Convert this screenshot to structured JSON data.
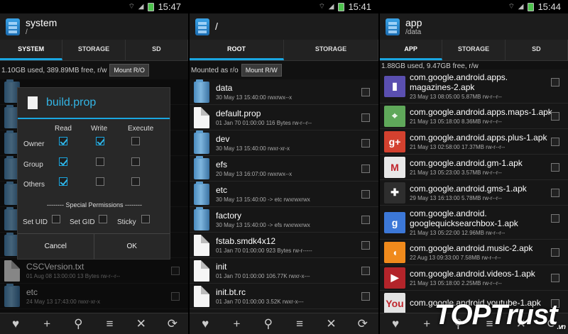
{
  "left": {
    "time": "15:47",
    "title": "system",
    "subtitle": "/",
    "tabs": [
      "SYSTEM",
      "STORAGE",
      "SD"
    ],
    "info": "1.10GB used, 389.89MB free, r/w",
    "mount_label": "Mount R/O",
    "bottom_items": [
      {
        "name": "CSCVersion.txt",
        "meta": "01 Aug 08 13:00:00   13 Bytes   rw-r--r--"
      },
      {
        "name": "etc",
        "meta": "24 May 13 17:43:00   rwxr-xr-x"
      }
    ],
    "dialog": {
      "title": "build.prop",
      "col_read": "Read",
      "col_write": "Write",
      "col_execute": "Execute",
      "owner": "Owner",
      "group": "Group",
      "others": "Others",
      "owner_checks": [
        true,
        true,
        false
      ],
      "group_checks": [
        true,
        false,
        false
      ],
      "others_checks": [
        true,
        false,
        false
      ],
      "special": "-------- Special Permissions --------",
      "set_uid": "Set UID",
      "set_gid": "Set GID",
      "sticky": "Sticky",
      "cancel": "Cancel",
      "ok": "OK"
    }
  },
  "middle": {
    "time": "15:41",
    "title": "/",
    "tabs": [
      "ROOT",
      "STORAGE"
    ],
    "info": "Mounted as r/o",
    "mount_label": "Mount R/W",
    "items": [
      {
        "name": "data",
        "meta": "30 May 13 15:40:00   rwxrwx--x",
        "type": "folder"
      },
      {
        "name": "default.prop",
        "meta": "01 Jan 70 01:00:00   116 Bytes   rw-r--r--",
        "type": "file"
      },
      {
        "name": "dev",
        "meta": "30 May 13 15:40:00   rwxr-xr-x",
        "type": "folder"
      },
      {
        "name": "efs",
        "meta": "20 May 13 16:07:00   rwxrwx--x",
        "type": "folder"
      },
      {
        "name": "etc",
        "meta": "30 May 13 15:40:00   -> etc   rwxrwxrwx",
        "type": "folder"
      },
      {
        "name": "factory",
        "meta": "30 May 13 15:40:00   -> efs   rwxrwxrwx",
        "type": "folder"
      },
      {
        "name": "fstab.smdk4x12",
        "meta": "01 Jan 70 01:00:00   923 Bytes   rw-r-----",
        "type": "file"
      },
      {
        "name": "init",
        "meta": "01 Jan 70 01:00:00   106.77K   rwxr-x---",
        "type": "file"
      },
      {
        "name": "init.bt.rc",
        "meta": "01 Jan 70 01:00:00   3.52K   rwxr-x---",
        "type": "file"
      }
    ]
  },
  "right": {
    "time": "15:44",
    "title": "app",
    "subtitle": "/data",
    "tabs": [
      "APP",
      "STORAGE",
      "SD"
    ],
    "info": "1.88GB used, 9.47GB free, r/w",
    "items": [
      {
        "name": "com.google.android.apps.\nmagazines-2.apk",
        "meta": "23 May 13 08:05:00   5.87MB   rw-r--r--",
        "color": "#5a4fb0",
        "glyph": "▮"
      },
      {
        "name": "com.google.android.apps.maps-1.apk",
        "meta": "21 May 13 05:18:00   8.36MB   rw-r--r--",
        "color": "#5fa85a",
        "glyph": "⌖"
      },
      {
        "name": "com.google.android.apps.plus-1.apk",
        "meta": "21 May 13 02:58:00   17.37MB   rw-r--r--",
        "color": "#d3412f",
        "glyph": "g+"
      },
      {
        "name": "com.google.android.gm-1.apk",
        "meta": "21 May 13 05:23:00   3.57MB   rw-r--r--",
        "color": "#e8e8e8",
        "glyph": "M"
      },
      {
        "name": "com.google.android.gms-1.apk",
        "meta": "29 May 13 16:13:00   5.78MB   rw-r--r--",
        "color": "#2e2e2e",
        "glyph": "✚"
      },
      {
        "name": "com.google.android.\ngooglequicksearchbox-1.apk",
        "meta": "21 May 13 05:22:00   12.96MB   rw-r--r--",
        "color": "#3c78d8",
        "glyph": "g"
      },
      {
        "name": "com.google.android.music-2.apk",
        "meta": "22 Aug 13 09:33:00   7.58MB   rw-r--r--",
        "color": "#f08a1c",
        "glyph": "◖"
      },
      {
        "name": "com.google.android.videos-1.apk",
        "meta": "21 May 13 05:18:00   2.25MB   rw-r--r--",
        "color": "#b3242a",
        "glyph": "▶"
      },
      {
        "name": "com.google.android.youtube-1.apk",
        "meta": "",
        "color": "#e3e3e3",
        "glyph": "You"
      }
    ]
  },
  "toolbar_icons": [
    "heart-icon",
    "plus-icon",
    "search-icon",
    "sort-icon",
    "close-icon",
    "refresh-icon"
  ],
  "watermark": "TOPTrust.vn"
}
